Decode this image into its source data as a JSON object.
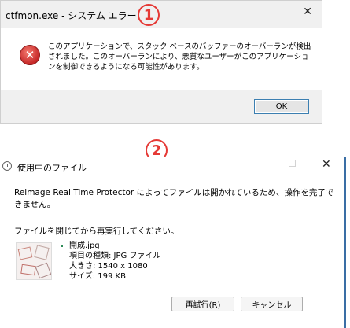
{
  "markers": {
    "one": "1",
    "two": "2"
  },
  "dialog1": {
    "title": "ctfmon.exe - システム エラー",
    "close_glyph": "✕",
    "error_glyph": "✕",
    "message": "このアプリケーションで、スタック ベースのバッファーのオーバーランが検出されました。このオーバーランにより、悪質なユーザーがこのアプリケーションを制御できるようになる可能性があります。",
    "ok_label": "OK"
  },
  "dialog2": {
    "title": "使用中のファイル",
    "min_glyph": "—",
    "max_glyph": "☐",
    "close_glyph": "✕",
    "message": "Reimage Real Time Protector によってファイルは開かれているため、操作を完了できません。",
    "instruction": "ファイルを閉じてから再実行してください。",
    "file": {
      "name": "開成.jpg",
      "type": "項目の種類: JPG ファイル",
      "dimensions": "大きさ: 1540 x 1080",
      "size": "サイズ: 199 KB"
    },
    "retry_label": "再試行(R)",
    "cancel_label": "キャンセル"
  }
}
